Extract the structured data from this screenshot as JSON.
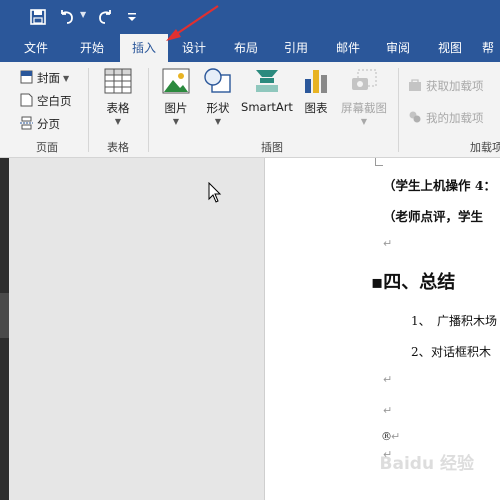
{
  "tabs": [
    {
      "label": "文件"
    },
    {
      "label": "开始"
    },
    {
      "label": "插入"
    },
    {
      "label": "设计"
    },
    {
      "label": "布局"
    },
    {
      "label": "引用"
    },
    {
      "label": "邮件"
    },
    {
      "label": "审阅"
    },
    {
      "label": "视图"
    },
    {
      "label": "帮"
    }
  ],
  "active_tab": "插入",
  "ribbon": {
    "pages": {
      "cover": "封面",
      "blank": "空白页",
      "break": "分页",
      "label": "页面"
    },
    "tables": {
      "table": "表格",
      "label": "表格"
    },
    "illustrations": {
      "pictures": "图片",
      "shapes": "形状",
      "smartart": "SmartArt",
      "chart": "图表",
      "screenshot": "屏幕截图",
      "label": "插图"
    },
    "addins": {
      "get": "获取加载项",
      "my": "我的加载项",
      "label": "加载项"
    }
  },
  "document": {
    "line1": "（学生上机操作 4：",
    "line2": "（老师点评，学生",
    "heading": "▪四、总结",
    "item1_num": "1、",
    "item1": "广播积木场",
    "item2_num": "2、",
    "item2": "对话框积木",
    "registered": "®",
    "para_mark": "↵"
  },
  "colors": {
    "accent": "#2b579a",
    "arrow": "#e03030"
  },
  "watermark": "Baidu 经验"
}
